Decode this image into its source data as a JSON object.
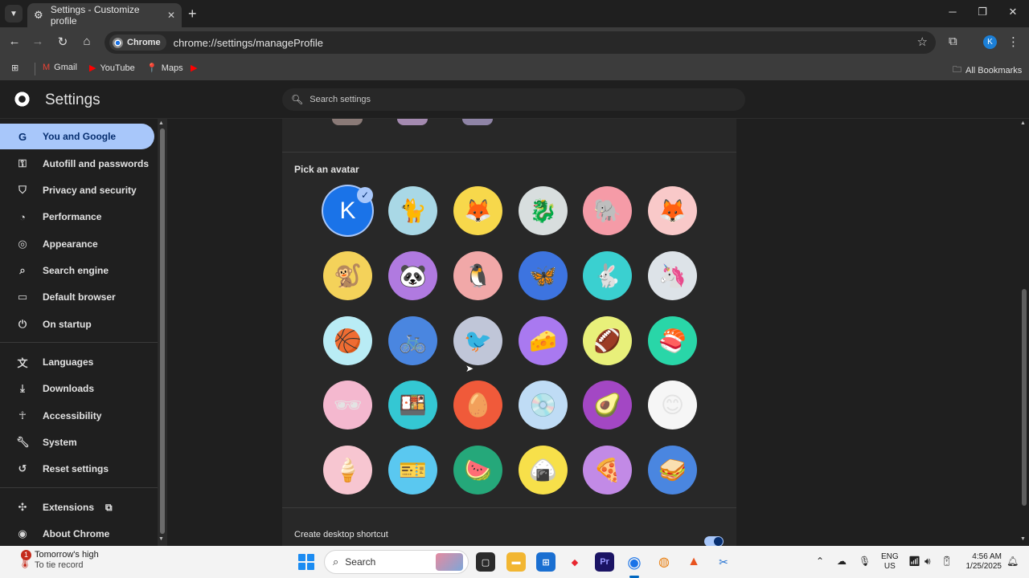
{
  "tab": {
    "title": "Settings - Customize profile"
  },
  "window": {
    "minimize": "─",
    "maximize": "❐",
    "close": "✕"
  },
  "omnibox": {
    "chip_label": "Chrome",
    "url": "chrome://settings/manageProfile"
  },
  "profile_initial": "K",
  "bookmarks": [
    {
      "label": "Gmail",
      "icon": "gmail-icon"
    },
    {
      "label": "YouTube",
      "icon": "youtube-icon"
    },
    {
      "label": "Maps",
      "icon": "maps-icon"
    }
  ],
  "all_bookmarks": "All Bookmarks",
  "settings": {
    "title": "Settings",
    "search_placeholder": "Search settings"
  },
  "sidebar": {
    "items": [
      {
        "label": "You and Google",
        "icon": "google-icon",
        "active": true
      },
      {
        "label": "Autofill and passwords",
        "icon": "key-icon"
      },
      {
        "label": "Privacy and security",
        "icon": "shield-icon"
      },
      {
        "label": "Performance",
        "icon": "speedometer-icon"
      },
      {
        "label": "Appearance",
        "icon": "palette-icon"
      },
      {
        "label": "Search engine",
        "icon": "search-icon"
      },
      {
        "label": "Default browser",
        "icon": "browser-icon"
      },
      {
        "label": "On startup",
        "icon": "power-icon"
      },
      {
        "label": "Languages",
        "icon": "translate-icon"
      },
      {
        "label": "Downloads",
        "icon": "download-icon"
      },
      {
        "label": "Accessibility",
        "icon": "accessibility-icon"
      },
      {
        "label": "System",
        "icon": "wrench-icon"
      },
      {
        "label": "Reset settings",
        "icon": "reset-icon"
      },
      {
        "label": "Extensions",
        "icon": "puzzle-icon"
      },
      {
        "label": "About Chrome",
        "icon": "chrome-icon"
      }
    ]
  },
  "main": {
    "pick_avatar_label": "Pick an avatar",
    "selected_avatar_letter": "K",
    "avatars": [
      "letter-k",
      "cat",
      "fox",
      "dragon",
      "elephant",
      "red-fox",
      "monkey",
      "panda",
      "penguin",
      "butterfly",
      "rabbit",
      "unicorn",
      "basketball",
      "bicycle",
      "bird",
      "cheese",
      "football",
      "sushi-plate",
      "sunglasses",
      "sushi",
      "tamagotchi",
      "vinyl-record",
      "avocado",
      "smiley",
      "ice-cream",
      "ticket",
      "watermelon",
      "onigiri",
      "pizza",
      "sandwich"
    ],
    "shortcut_label": "Create desktop shortcut",
    "shortcut_enabled": true
  },
  "taskbar": {
    "weather_title": "Tomorrow's high",
    "weather_sub": "To tie record",
    "weather_badge": "1",
    "search_placeholder": "Search",
    "lang_line1": "ENG",
    "lang_line2": "US",
    "time": "4:56 AM",
    "date": "1/25/2025"
  }
}
